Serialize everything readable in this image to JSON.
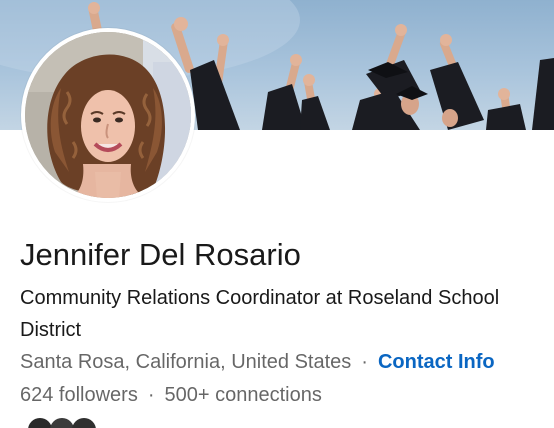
{
  "profile": {
    "name": "Jennifer Del Rosario",
    "headline": "Community Relations Coordinator at Roseland School District",
    "location": "Santa Rosa, California, United States",
    "separator": "·",
    "contact_info_label": "Contact Info",
    "followers": "624 followers",
    "connections": "500+ connections"
  },
  "icons": {
    "banner": "graduation-cap-toss-image",
    "avatar": "profile-photo"
  },
  "colors": {
    "link": "#0a66c2",
    "text_primary": "#1f1f1f",
    "text_secondary": "#666666"
  }
}
